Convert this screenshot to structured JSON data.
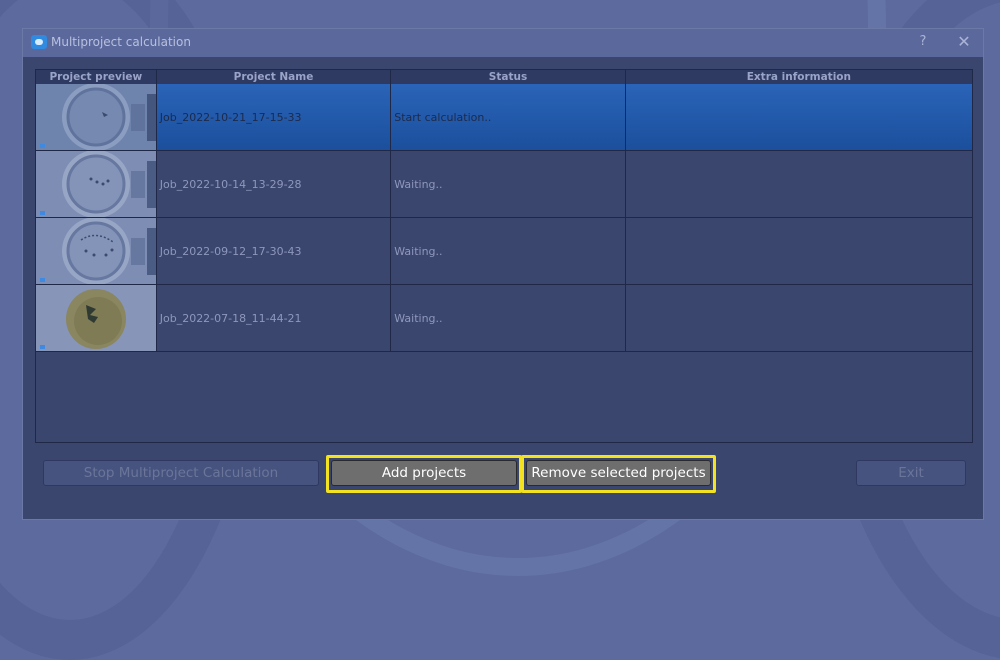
{
  "window": {
    "title": "Multiproject calculation",
    "help_label": "?",
    "close_label": "✕"
  },
  "table": {
    "columns": [
      "Project preview",
      "Project Name",
      "Status",
      "Extra information"
    ],
    "rows": [
      {
        "name": "Job_2022-10-21_17-15-33",
        "status": "Start calculation..",
        "extra": "",
        "selected": true
      },
      {
        "name": "Job_2022-10-14_13-29-28",
        "status": "Waiting..",
        "extra": "",
        "selected": false
      },
      {
        "name": "Job_2022-09-12_17-30-43",
        "status": "Waiting..",
        "extra": "",
        "selected": false
      },
      {
        "name": "Job_2022-07-18_11-44-21",
        "status": "Waiting..",
        "extra": "",
        "selected": false
      }
    ]
  },
  "buttons": {
    "stop": "Stop Multiproject Calculation",
    "add": "Add projects",
    "remove": "Remove selected projects",
    "exit": "Exit"
  },
  "colors": {
    "highlight": "#f3e21f",
    "selected_row": "#2a64b8",
    "window_bg": "#3b466f"
  }
}
